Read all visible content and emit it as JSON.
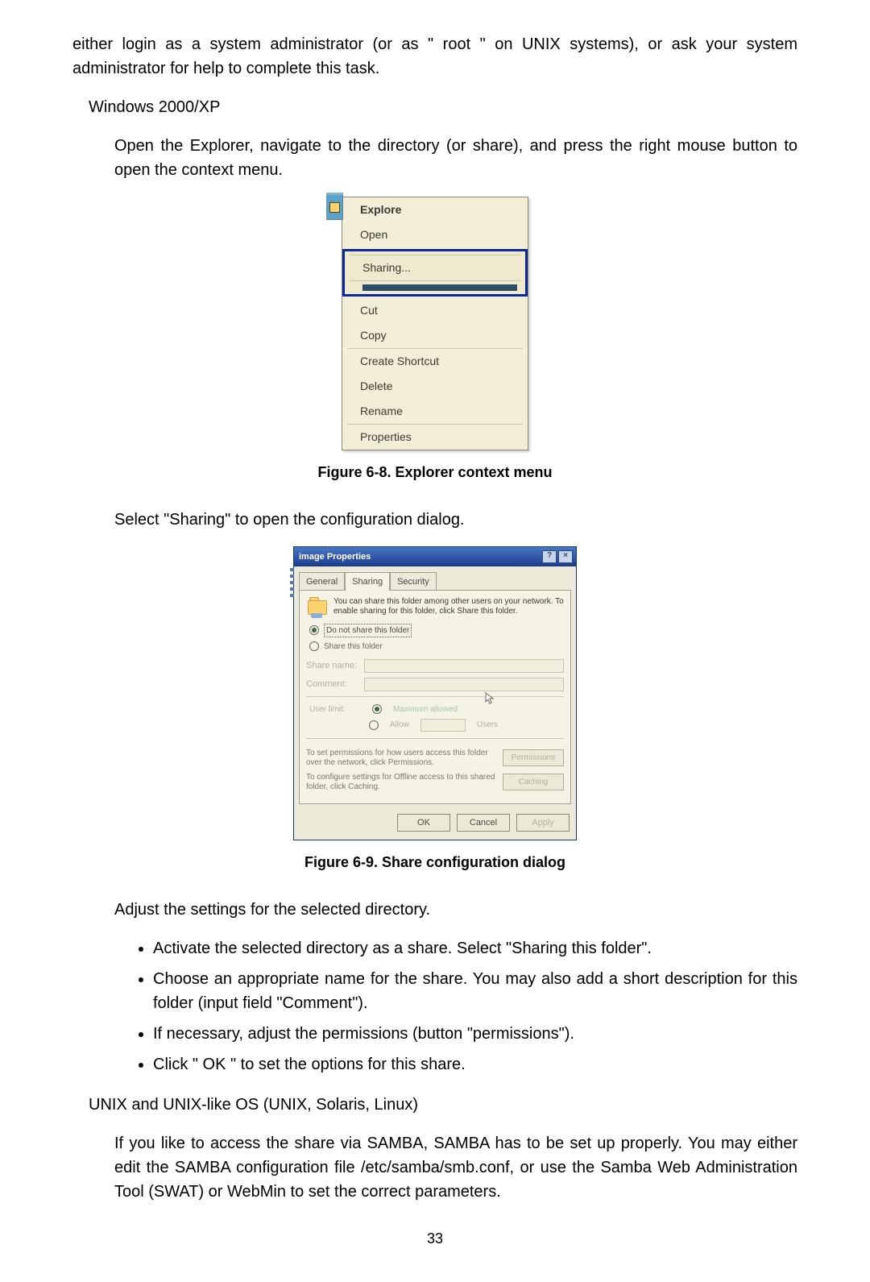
{
  "body": {
    "p1": "either login as a system administrator (or as \" root \" on UNIX systems), or ask your system administrator for help to complete this task.",
    "h_win": "Windows 2000/XP",
    "p2": "Open the Explorer, navigate to the directory (or share), and press the right mouse button to open the context menu.",
    "fig68": "Figure 6-8. Explorer context menu",
    "p3": "Select \"Sharing\" to open the configuration dialog.",
    "fig69": "Figure 6-9. Share configuration dialog",
    "p4": "Adjust the settings for the selected directory.",
    "b1": "Activate the selected directory as a share. Select \"Sharing this folder\".",
    "b2": "Choose an appropriate name for the share. You may also add a short description for this folder (input field \"Comment\").",
    "b3": "If necessary, adjust the permissions (button \"permissions\").",
    "b4": "Click \" OK \" to set the options for this share.",
    "h_unix": "UNIX and UNIX-like OS (UNIX, Solaris, Linux)",
    "p5": "If you like to access the share via SAMBA, SAMBA has to be set up properly. You may either edit the SAMBA configuration file /etc/samba/smb.conf, or use the Samba Web Administration Tool (SWAT) or WebMin to set the correct parameters.",
    "page_num": "33"
  },
  "ctx": {
    "explore": "Explore",
    "open": "Open",
    "sharing": "Sharing...",
    "cut": "Cut",
    "copy": "Copy",
    "create_shortcut": "Create Shortcut",
    "delete": "Delete",
    "rename": "Rename",
    "properties": "Properties"
  },
  "dlg": {
    "title": "image Properties",
    "close": "×",
    "help": "?",
    "tabs": {
      "general": "General",
      "sharing": "Sharing",
      "security": "Security"
    },
    "info": "You can share this folder among other users on your network. To enable sharing for this folder, click Share this folder.",
    "opt_noshare": "Do not share this folder",
    "opt_share": "Share this folder",
    "share_name_label": "Share name:",
    "comment_label": "Comment:",
    "user_limit_label": "User limit:",
    "max_allowed": "Maximum allowed",
    "allow": "Allow",
    "users": "Users",
    "perm_txt": "To set permissions for how users access this folder over the network, click Permissions.",
    "perm_btn": "Permissions",
    "cache_txt": "To configure settings for Offline access to this shared folder, click Caching.",
    "cache_btn": "Caching",
    "ok": "OK",
    "cancel": "Cancel",
    "apply": "Apply"
  }
}
